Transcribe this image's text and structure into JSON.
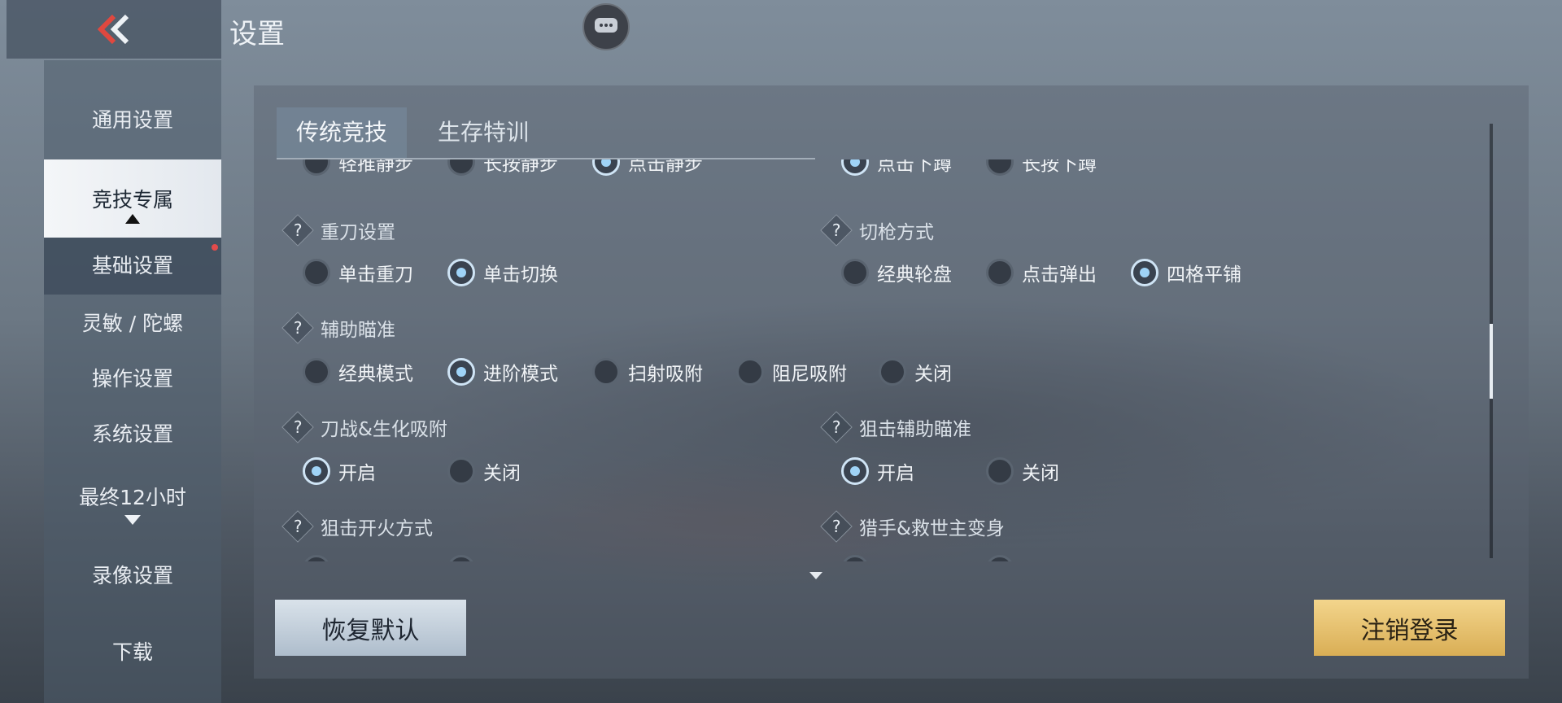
{
  "header": {
    "title": "设置",
    "back_icon": "double-chevron-left-icon",
    "chat_icon": "chat-bubble-icon"
  },
  "sidebar": {
    "items": [
      {
        "label": "通用设置"
      },
      {
        "label": "竞技专属",
        "active": true
      },
      {
        "label": "基础设置",
        "badge": "red-dot"
      },
      {
        "label": "灵敏 / 陀螺"
      },
      {
        "label": "操作设置"
      },
      {
        "label": "系统设置"
      },
      {
        "label": "最终12小时"
      },
      {
        "label": "录像设置"
      },
      {
        "label": "下载"
      }
    ]
  },
  "tabs": [
    {
      "label": "传统竞技",
      "active": true
    },
    {
      "label": "生存特训",
      "active": false
    }
  ],
  "partial_row": {
    "left": [
      "轻推静步",
      "长按静步",
      "点击静步"
    ],
    "left_selected": 2,
    "right": [
      "点击下蹲",
      "长按下蹲"
    ],
    "right_selected": 0
  },
  "settings": {
    "heavy_blade": {
      "title": "重刀设置",
      "options": [
        "单击重刀",
        "单击切换"
      ],
      "selected": 1
    },
    "weapon_switch": {
      "title": "切枪方式",
      "options": [
        "经典轮盘",
        "点击弹出",
        "四格平铺"
      ],
      "selected": 2
    },
    "aim_assist": {
      "title": "辅助瞄准",
      "options": [
        "经典模式",
        "进阶模式",
        "扫射吸附",
        "阻尼吸附",
        "关闭"
      ],
      "selected": 1
    },
    "melee_adsorb": {
      "title": "刀战&生化吸附",
      "options": [
        "开启",
        "关闭"
      ],
      "selected": 0
    },
    "sniper_assist": {
      "title": "狙击辅助瞄准",
      "options": [
        "开启",
        "关闭"
      ],
      "selected": 0
    },
    "sniper_fire": {
      "title": "狙击开火方式"
    },
    "hunter_transform": {
      "title": "猎手&救世主变身"
    }
  },
  "help_symbol": "?",
  "buttons": {
    "reset": "恢复默认",
    "logout": "注销登录"
  },
  "colors": {
    "accent_gold": "#e8c270",
    "radio_selected": "#9fd3f7",
    "badge_red": "#e24b4b"
  }
}
